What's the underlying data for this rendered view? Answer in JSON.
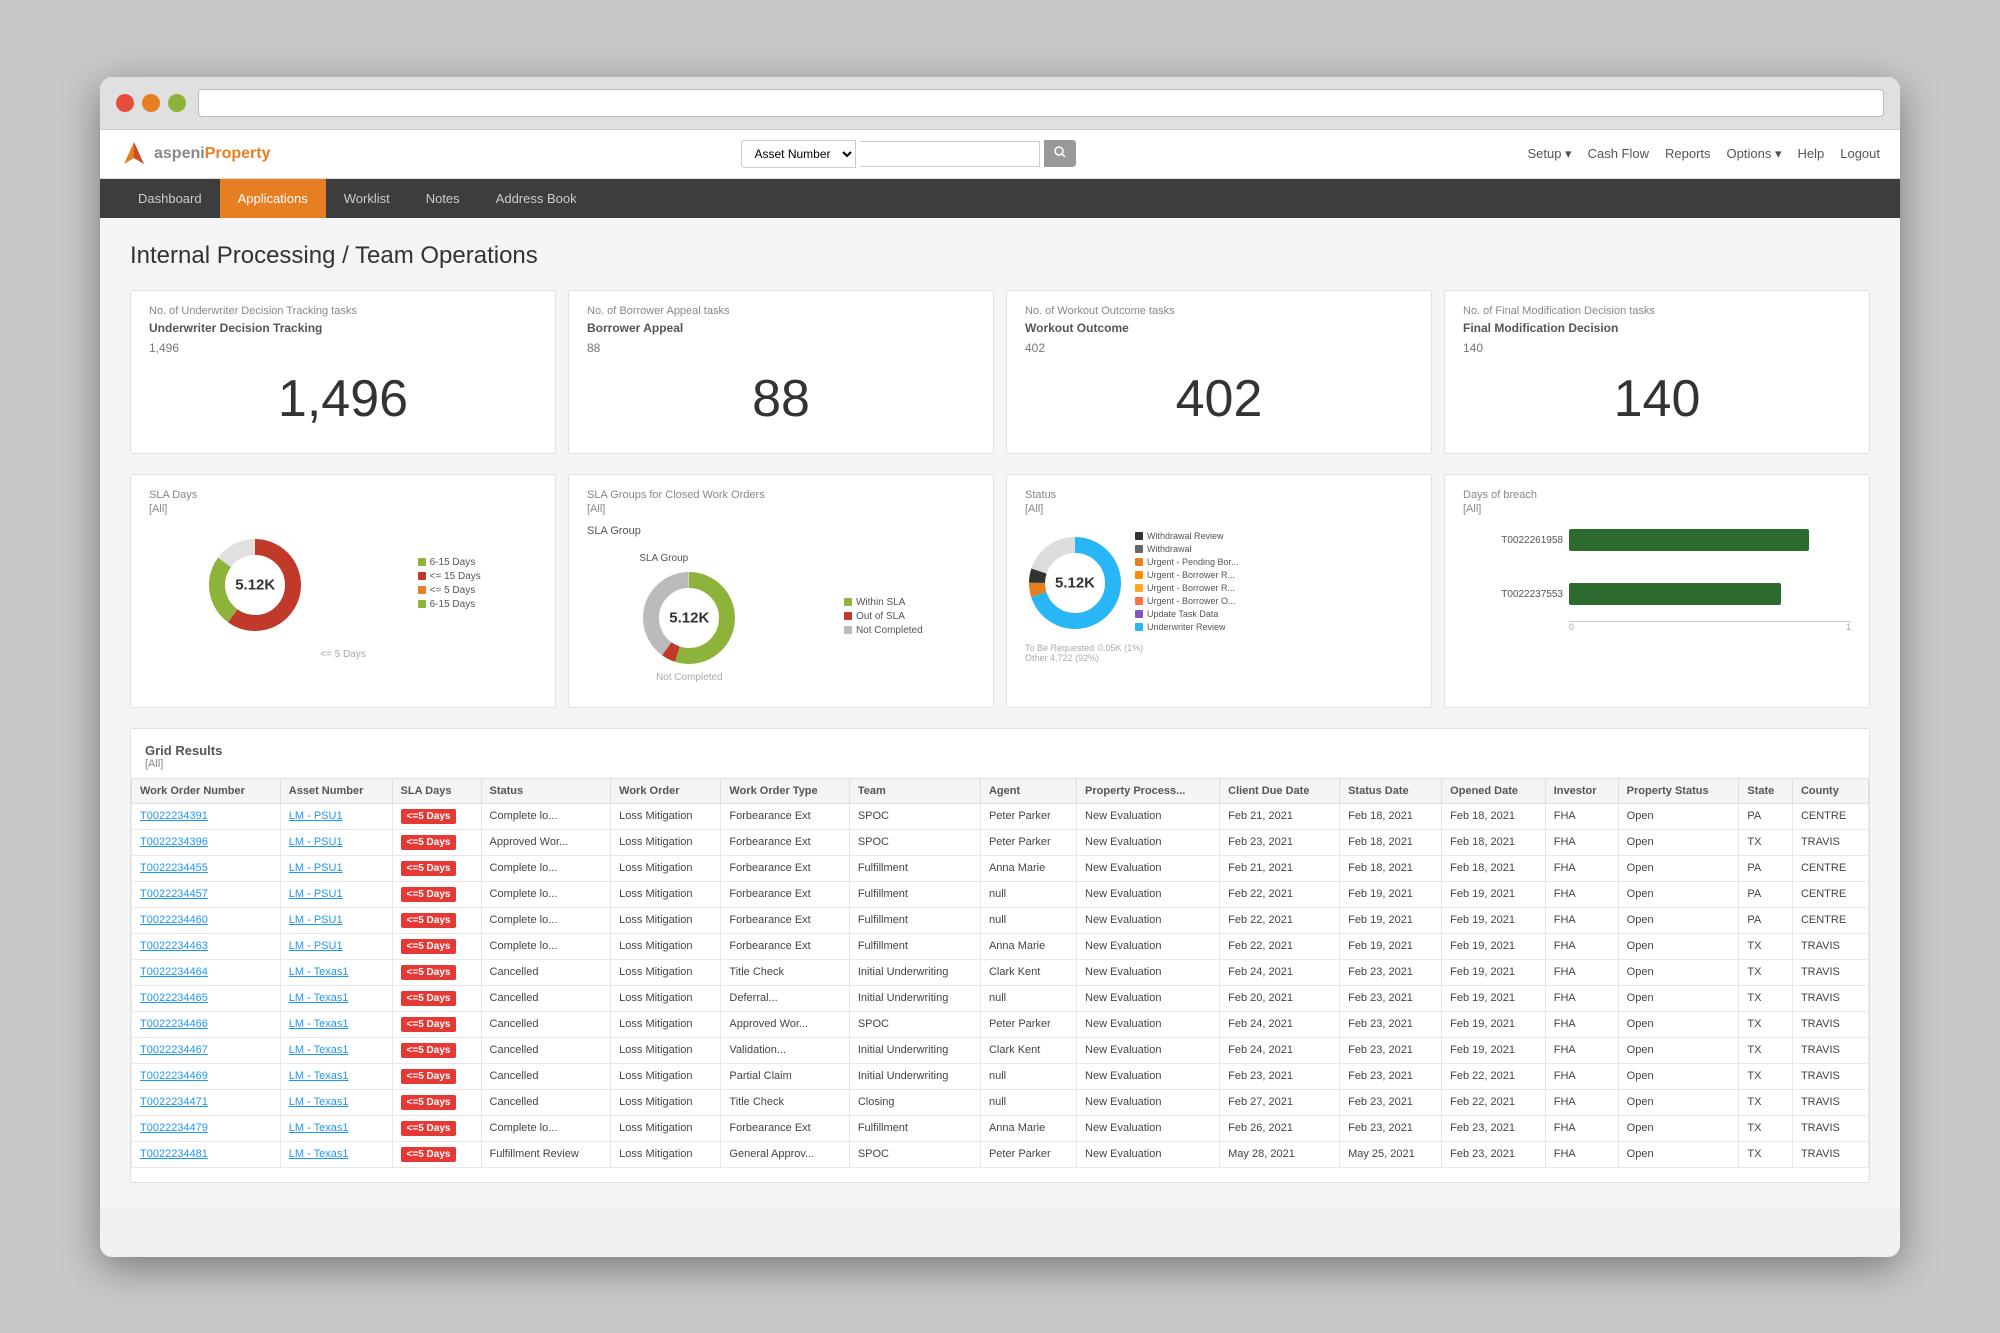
{
  "browser": {
    "url": ""
  },
  "app": {
    "logo_text_1": "aspeni",
    "logo_text_2": "Property",
    "search_select_default": "Asset Number",
    "search_placeholder": "",
    "top_nav_items": [
      {
        "label": "Setup",
        "has_dropdown": true
      },
      {
        "label": "Cash Flow"
      },
      {
        "label": "Reports"
      },
      {
        "label": "Options",
        "has_dropdown": true
      },
      {
        "label": "Help"
      },
      {
        "label": "Logout"
      }
    ]
  },
  "nav": {
    "items": [
      {
        "label": "Dashboard",
        "active": false
      },
      {
        "label": "Applications",
        "active": true
      },
      {
        "label": "Worklist",
        "active": false
      },
      {
        "label": "Notes",
        "active": false
      },
      {
        "label": "Address Book",
        "active": false
      }
    ]
  },
  "page": {
    "title": "Internal Processing / Team Operations"
  },
  "stats": [
    {
      "label": "No. of Underwriter Decision Tracking tasks",
      "sublabel": "Underwriter Decision Tracking",
      "subvalue": "1,496",
      "number": "1,496"
    },
    {
      "label": "No. of Borrower Appeal tasks",
      "sublabel": "Borrower Appeal",
      "subvalue": "88",
      "number": "88"
    },
    {
      "label": "No. of Workout Outcome tasks",
      "sublabel": "Workout Outcome",
      "subvalue": "402",
      "number": "402"
    },
    {
      "label": "No. of Final Modification Decision tasks",
      "sublabel": "Final Modification Decision",
      "subvalue": "140",
      "number": "140"
    }
  ],
  "charts": [
    {
      "title": "SLA Days",
      "filter": "[All]",
      "center_value": "5.12K",
      "type": "donut",
      "legend": [
        {
          "color": "#8db33a",
          "label": "6-15 Days"
        },
        {
          "color": "#c0392b",
          "label": "<= 15 Days"
        },
        {
          "color": "#e67e22",
          "label": "<= 5 Days"
        },
        {
          "color": "#8db33a",
          "label": "6-15 Days"
        }
      ],
      "segments": [
        {
          "color": "#c0392b",
          "value": 60
        },
        {
          "color": "#8db33a",
          "value": 25
        },
        {
          "color": "#e0e0e0",
          "value": 15
        }
      ]
    },
    {
      "title": "SLA Groups for Closed Work Orders",
      "filter": "[All]",
      "center_value": "5.12K",
      "type": "donut",
      "legend": [
        {
          "color": "#8db33a",
          "label": "Within SLA"
        },
        {
          "color": "#c0392b",
          "label": "Out of SLA"
        },
        {
          "color": "#bbb",
          "label": "Not Completed"
        }
      ],
      "segments": [
        {
          "color": "#8db33a",
          "value": 55
        },
        {
          "color": "#c0392b",
          "value": 5
        },
        {
          "color": "#bbb",
          "value": 40
        }
      ]
    },
    {
      "title": "Status",
      "filter": "[All]",
      "center_value": "5.12K",
      "type": "donut",
      "legend": [
        {
          "color": "#333",
          "label": "Withdrawal Review"
        },
        {
          "color": "#666",
          "label": "Withdrawal"
        },
        {
          "color": "#e67e22",
          "label": "Urgent - Pending Bor..."
        },
        {
          "color": "#fb8c00",
          "label": "Urgent - Borrower R..."
        },
        {
          "color": "#ffa726",
          "label": "Urgent - Borrower R..."
        },
        {
          "color": "#ff7043",
          "label": "Urgent - Borrower O..."
        },
        {
          "color": "#7e57c2",
          "label": "Update Task Data"
        },
        {
          "color": "#29b6f6",
          "label": "Underwriter Review"
        }
      ],
      "segments": [
        {
          "color": "#29b6f6",
          "value": 70
        },
        {
          "color": "#e67e22",
          "value": 5
        },
        {
          "color": "#333",
          "value": 5
        },
        {
          "color": "#bbb",
          "value": 20
        }
      ]
    },
    {
      "title": "Days of breach",
      "filter": "[All]",
      "type": "bar",
      "bars": [
        {
          "label": "T0022261958",
          "value": 85
        },
        {
          "label": "T0022237553",
          "value": 75
        }
      ]
    }
  ],
  "grid": {
    "title": "Grid Results",
    "filter": "[All]",
    "columns": [
      "Work Order Number",
      "Asset Number",
      "SLA Days",
      "Status",
      "Work Order",
      "Work Order Type",
      "Team",
      "Agent",
      "Property Process...",
      "Client Due Date",
      "Status Date",
      "Opened Date",
      "Investor",
      "Property Status",
      "State",
      "County"
    ],
    "rows": [
      [
        "T0022234391",
        "LM - PSU1",
        "<=5 Days",
        "Complete lo...",
        "Loss Mitigation",
        "Forbearance Ext",
        "SPOC",
        "Peter Parker",
        "New Evaluation",
        "Feb 21, 2021",
        "Feb 18, 2021",
        "Feb 18, 2021",
        "FHA",
        "Open",
        "PA",
        "CENTRE"
      ],
      [
        "T0022234396",
        "LM - PSU1",
        "<=5 Days",
        "Approved Wor...",
        "Loss Mitigation",
        "Forbearance Ext",
        "SPOC",
        "Peter Parker",
        "New Evaluation",
        "Feb 23, 2021",
        "Feb 18, 2021",
        "Feb 18, 2021",
        "FHA",
        "Open",
        "TX",
        "TRAVIS"
      ],
      [
        "T0022234455",
        "LM - PSU1",
        "<=5 Days",
        "Complete lo...",
        "Loss Mitigation",
        "Forbearance Ext",
        "Fulfillment",
        "Anna Marie",
        "New Evaluation",
        "Feb 21, 2021",
        "Feb 18, 2021",
        "Feb 18, 2021",
        "FHA",
        "Open",
        "PA",
        "CENTRE"
      ],
      [
        "T0022234457",
        "LM - PSU1",
        "<=5 Days",
        "Complete lo...",
        "Loss Mitigation",
        "Forbearance Ext",
        "Fulfillment",
        "null",
        "New Evaluation",
        "Feb 22, 2021",
        "Feb 19, 2021",
        "Feb 19, 2021",
        "FHA",
        "Open",
        "PA",
        "CENTRE"
      ],
      [
        "T0022234460",
        "LM - PSU1",
        "<=5 Days",
        "Complete lo...",
        "Loss Mitigation",
        "Forbearance Ext",
        "Fulfillment",
        "null",
        "New Evaluation",
        "Feb 22, 2021",
        "Feb 19, 2021",
        "Feb 19, 2021",
        "FHA",
        "Open",
        "PA",
        "CENTRE"
      ],
      [
        "T0022234463",
        "LM - PSU1",
        "<=5 Days",
        "Complete lo...",
        "Loss Mitigation",
        "Forbearance Ext",
        "Fulfillment",
        "Anna Marie",
        "New Evaluation",
        "Feb 22, 2021",
        "Feb 19, 2021",
        "Feb 19, 2021",
        "FHA",
        "Open",
        "TX",
        "TRAVIS"
      ],
      [
        "T0022234464",
        "LM - Texas1",
        "<=5 Days",
        "Cancelled",
        "Loss Mitigation",
        "Title Check",
        "Initial Underwriting",
        "Clark Kent",
        "New Evaluation",
        "Feb 24, 2021",
        "Feb 23, 2021",
        "Feb 19, 2021",
        "FHA",
        "Open",
        "TX",
        "TRAVIS"
      ],
      [
        "T0022234465",
        "LM - Texas1",
        "<=5 Days",
        "Cancelled",
        "Loss Mitigation",
        "Deferral...",
        "Initial Underwriting",
        "null",
        "New Evaluation",
        "Feb 20, 2021",
        "Feb 23, 2021",
        "Feb 19, 2021",
        "FHA",
        "Open",
        "TX",
        "TRAVIS"
      ],
      [
        "T0022234466",
        "LM - Texas1",
        "<=5 Days",
        "Cancelled",
        "Loss Mitigation",
        "Approved Wor...",
        "SPOC",
        "Peter Parker",
        "New Evaluation",
        "Feb 24, 2021",
        "Feb 23, 2021",
        "Feb 19, 2021",
        "FHA",
        "Open",
        "TX",
        "TRAVIS"
      ],
      [
        "T0022234467",
        "LM - Texas1",
        "<=5 Days",
        "Cancelled",
        "Loss Mitigation",
        "Validation...",
        "Initial Underwriting",
        "Clark Kent",
        "New Evaluation",
        "Feb 24, 2021",
        "Feb 23, 2021",
        "Feb 19, 2021",
        "FHA",
        "Open",
        "TX",
        "TRAVIS"
      ],
      [
        "T0022234469",
        "LM - Texas1",
        "<=5 Days",
        "Cancelled",
        "Loss Mitigation",
        "Partial Claim",
        "Initial Underwriting",
        "null",
        "New Evaluation",
        "Feb 23, 2021",
        "Feb 23, 2021",
        "Feb 22, 2021",
        "FHA",
        "Open",
        "TX",
        "TRAVIS"
      ],
      [
        "T0022234471",
        "LM - Texas1",
        "<=5 Days",
        "Cancelled",
        "Loss Mitigation",
        "Title Check",
        "Closing",
        "null",
        "New Evaluation",
        "Feb 27, 2021",
        "Feb 23, 2021",
        "Feb 22, 2021",
        "FHA",
        "Open",
        "TX",
        "TRAVIS"
      ],
      [
        "T0022234479",
        "LM - Texas1",
        "<=5 Days",
        "Complete lo...",
        "Loss Mitigation",
        "Forbearance Ext",
        "Fulfillment",
        "Anna Marie",
        "New Evaluation",
        "Feb 26, 2021",
        "Feb 23, 2021",
        "Feb 23, 2021",
        "FHA",
        "Open",
        "TX",
        "TRAVIS"
      ],
      [
        "T0022234481",
        "LM - Texas1",
        "<=5 Days",
        "Fulfillment Review",
        "Loss Mitigation",
        "General Approv...",
        "SPOC",
        "Peter Parker",
        "New Evaluation",
        "May 28, 2021",
        "May 25, 2021",
        "Feb 23, 2021",
        "FHA",
        "Open",
        "TX",
        "TRAVIS"
      ]
    ],
    "sla_red_threshold": "<=5 Days"
  }
}
